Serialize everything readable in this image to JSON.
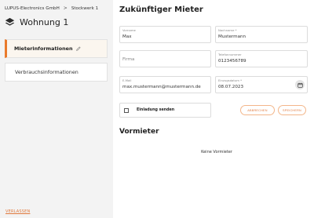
{
  "breadcrumb": {
    "company": "LUPUS-Electronics GmbH",
    "separator": ">",
    "floor": "Stockwerk 1"
  },
  "unit": {
    "title": "Wohnung 1",
    "icon": "layers-icon"
  },
  "sidebar": {
    "items": [
      {
        "label": "Mieterinformationen",
        "active": true,
        "icon": "pencil-icon"
      },
      {
        "label": "Verbrauchsinformationen",
        "active": false
      }
    ]
  },
  "future_tenant": {
    "heading": "Zukünftiger Mieter",
    "first_name": {
      "label": "Vorname",
      "value": "Max"
    },
    "last_name": {
      "label": "Nachname *",
      "value": "Mustermann"
    },
    "company": {
      "placeholder": "Firma"
    },
    "phone": {
      "label": "Telefonnummer",
      "value": "0123456789"
    },
    "email": {
      "label": "E-Mail",
      "value": "max.mustermann@mustermann.de"
    },
    "move_in": {
      "label": "Einzugsdatum *",
      "value": "08.07.2023"
    },
    "invite": {
      "label": "Einladung senden",
      "checked": false
    },
    "cancel_label": "ABBRECHEN",
    "save_label": "SPEICHERN"
  },
  "previous_tenant": {
    "heading": "Vormieter",
    "empty_text": "Keine Vormieter"
  },
  "leave_label": "VERLASSEN",
  "colors": {
    "accent": "#e97a2c",
    "sidebar_bg": "#f3f3f3",
    "active_item_bg": "#fbf6ef"
  }
}
